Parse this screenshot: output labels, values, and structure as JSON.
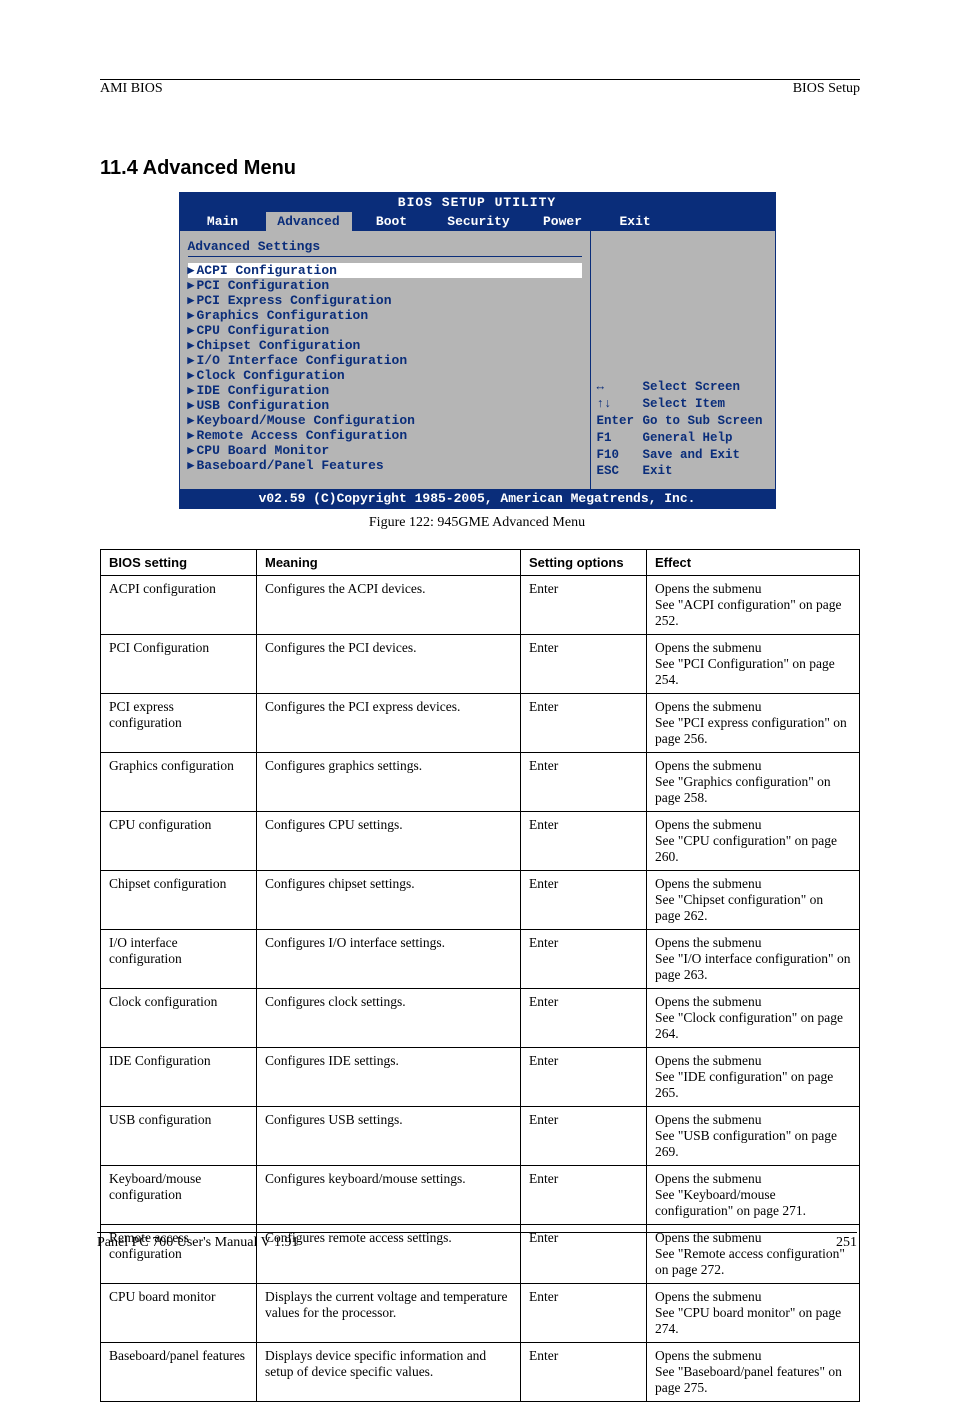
{
  "header": {
    "left": "AMI BIOS",
    "right": "BIOS Setup"
  },
  "title": "11.4 Advanced Menu",
  "bios": {
    "title": "BIOS SETUP UTILITY",
    "tabs": {
      "main": "Main",
      "advanced": "Advanced",
      "boot": "Boot",
      "security": "Security",
      "power": "Power",
      "exit": "Exit"
    },
    "heading": "Advanced Settings",
    "items": [
      "ACPI Configuration",
      "PCI Configuration",
      "PCI Express Configuration",
      "Graphics Configuration",
      "CPU Configuration",
      "Chipset Configuration",
      "I/O Interface Configuration",
      "Clock Configuration",
      "IDE Configuration",
      "USB Configuration",
      "Keyboard/Mouse Configuration",
      "Remote Access Configuration",
      "CPU Board Monitor",
      "Baseboard/Panel Features"
    ],
    "help": [
      {
        "key": "↔",
        "txt": "Select Screen"
      },
      {
        "key": "↑↓",
        "txt": "Select Item"
      },
      {
        "key": "Enter",
        "txt": "Go to Sub Screen"
      },
      {
        "key": "F1",
        "txt": "General Help"
      },
      {
        "key": "F10",
        "txt": "Save and Exit"
      },
      {
        "key": "ESC",
        "txt": "Exit"
      }
    ],
    "footer": "v02.59 (C)Copyright 1985-2005, American Megatrends, Inc."
  },
  "figlabel": "Figure 122: 945GME Advanced Menu",
  "table": {
    "headers": [
      "BIOS setting",
      "Meaning",
      "Setting options",
      "Effect"
    ],
    "rows": [
      [
        "ACPI configuration",
        "Configures the ACPI devices.",
        "Enter",
        "Opens the submenu\nSee \"ACPI configuration\" on page 252."
      ],
      [
        "PCI Configuration",
        "Configures the PCI devices.",
        "Enter",
        "Opens the submenu\nSee \"PCI Configuration\" on page 254."
      ],
      [
        "PCI express configuration",
        "Configures the PCI express devices.",
        "Enter",
        "Opens the submenu\nSee \"PCI express configuration\" on page 256."
      ],
      [
        "Graphics configuration",
        "Configures graphics settings.",
        "Enter",
        "Opens the submenu\nSee \"Graphics configuration\" on page 258."
      ],
      [
        "CPU configuration",
        "Configures CPU settings.",
        "Enter",
        "Opens the submenu\nSee \"CPU configuration\" on page 260."
      ],
      [
        "Chipset configuration",
        "Configures chipset settings.",
        "Enter",
        "Opens the submenu\nSee \"Chipset configuration\" on page 262."
      ],
      [
        "I/O interface configuration",
        "Configures I/O interface settings.",
        "Enter",
        "Opens the submenu\nSee \"I/O interface configuration\" on page 263."
      ],
      [
        "Clock configuration",
        "Configures clock settings.",
        "Enter",
        "Opens the submenu\nSee \"Clock configuration\" on page 264."
      ],
      [
        "IDE Configuration",
        "Configures IDE settings.",
        "Enter",
        "Opens the submenu\nSee \"IDE configuration\" on page 265."
      ],
      [
        "USB configuration",
        "Configures USB settings.",
        "Enter",
        "Opens the submenu\nSee \"USB configuration\" on page 269."
      ],
      [
        "Keyboard/mouse configuration",
        "Configures keyboard/mouse settings.",
        "Enter",
        "Opens the submenu\nSee \"Keyboard/mouse configuration\" on page 271."
      ],
      [
        "Remote access configuration",
        "Configures remote access settings.",
        "Enter",
        "Opens the submenu\nSee \"Remote access configuration\" on page 272."
      ],
      [
        "CPU board monitor",
        "Displays the current voltage and temperature values for the processor.",
        "Enter",
        "Opens the submenu\nSee \"CPU board monitor\" on page 274."
      ],
      [
        "Baseboard/panel features",
        "Displays device specific information and setup of device specific values.",
        "Enter",
        "Opens the submenu\nSee \"Baseboard/panel features\" on page 275."
      ]
    ]
  },
  "footer": {
    "left": "Panel PC 700 User's Manual V 1.91",
    "right": "251"
  }
}
